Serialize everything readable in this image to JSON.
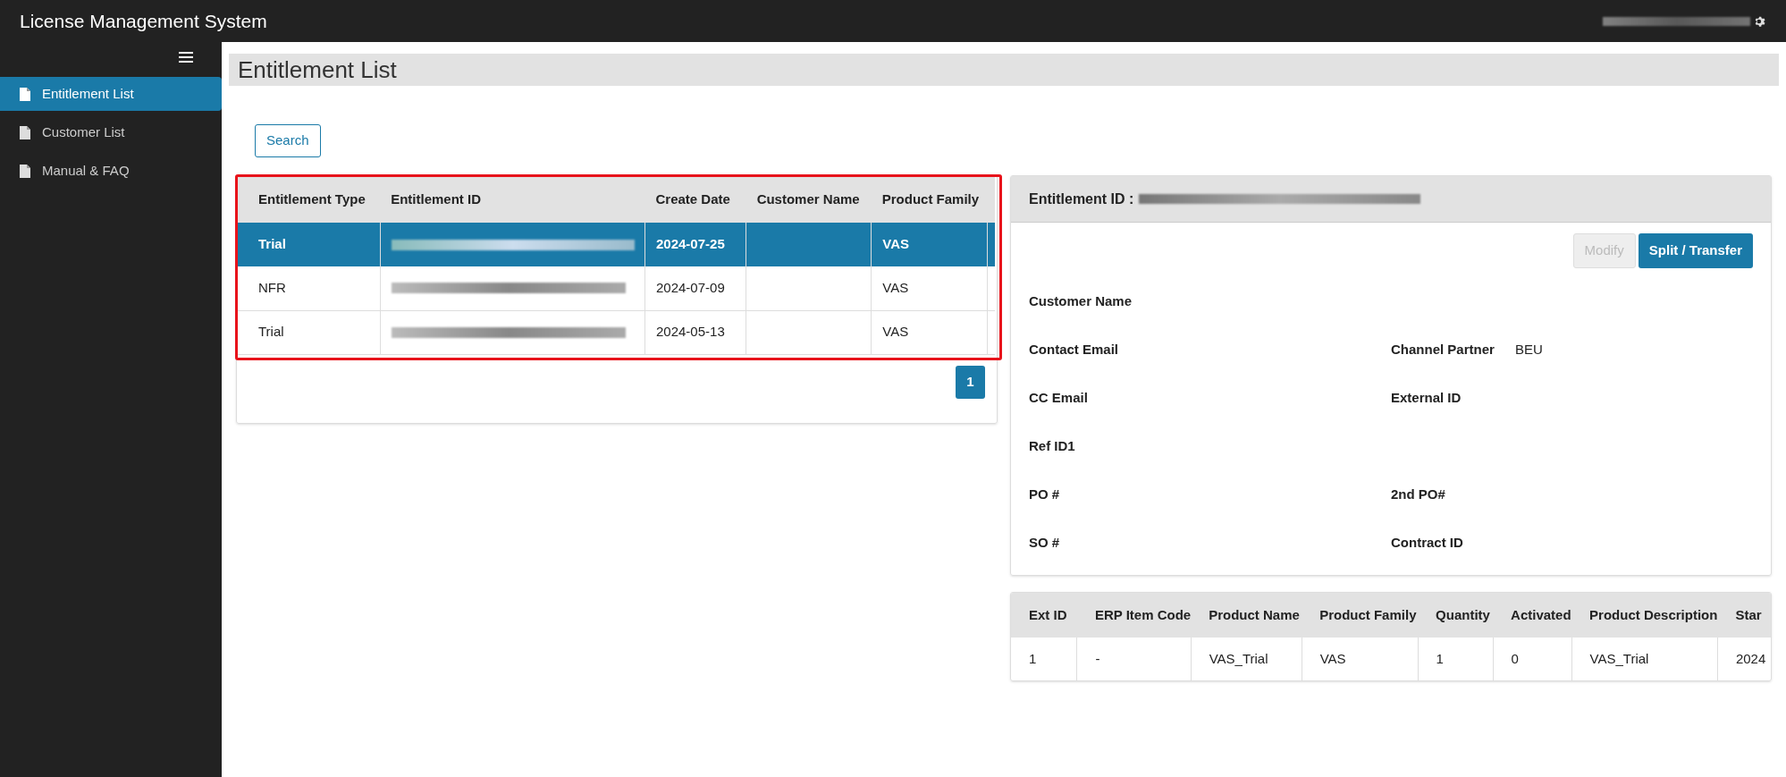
{
  "app_title": "License Management System",
  "sidebar": {
    "items": [
      {
        "label": "Entitlement List",
        "selected": true
      },
      {
        "label": "Customer List",
        "selected": false
      },
      {
        "label": "Manual & FAQ",
        "selected": false
      }
    ]
  },
  "page_title": "Entitlement List",
  "search_button": "Search",
  "entitlements": {
    "columns": [
      "Entitlement Type",
      "Entitlement ID",
      "Create Date",
      "Customer Name",
      "Product Family"
    ],
    "rows": [
      {
        "type": "Trial",
        "create_date": "2024-07-25",
        "product_family": "VAS",
        "selected": true
      },
      {
        "type": "NFR",
        "create_date": "2024-07-09",
        "product_family": "VAS",
        "selected": false
      },
      {
        "type": "Trial",
        "create_date": "2024-05-13",
        "product_family": "VAS",
        "selected": false
      }
    ],
    "pages": [
      {
        "label": "1",
        "selected": true
      }
    ]
  },
  "detail": {
    "title": "Entitlement ID :",
    "buttons": [
      {
        "label": "Modify",
        "disabled": true
      },
      {
        "label": "Split / Transfer",
        "disabled": false
      }
    ],
    "fields": [
      [
        {
          "label": "Customer Name"
        }
      ],
      [
        {
          "label": "Contact Email"
        },
        {
          "label": "Channel Partner",
          "value": "BEU"
        }
      ],
      [
        {
          "label": "CC Email"
        },
        {
          "label": "External ID"
        }
      ],
      [
        {
          "label": "Ref ID1"
        }
      ],
      [
        {
          "label": "PO #"
        },
        {
          "label": "2nd PO#"
        }
      ],
      [
        {
          "label": "SO #"
        },
        {
          "label": "Contract ID"
        }
      ]
    ]
  },
  "items": {
    "columns": [
      "Ext ID",
      "ERP Item Code",
      "Product Name",
      "Product Family",
      "Quantity",
      "Activated",
      "Product Description",
      "Star"
    ],
    "rows": [
      [
        "1",
        "-",
        "VAS_Trial",
        "VAS",
        "1",
        "0",
        "VAS_Trial",
        "2024"
      ]
    ]
  }
}
